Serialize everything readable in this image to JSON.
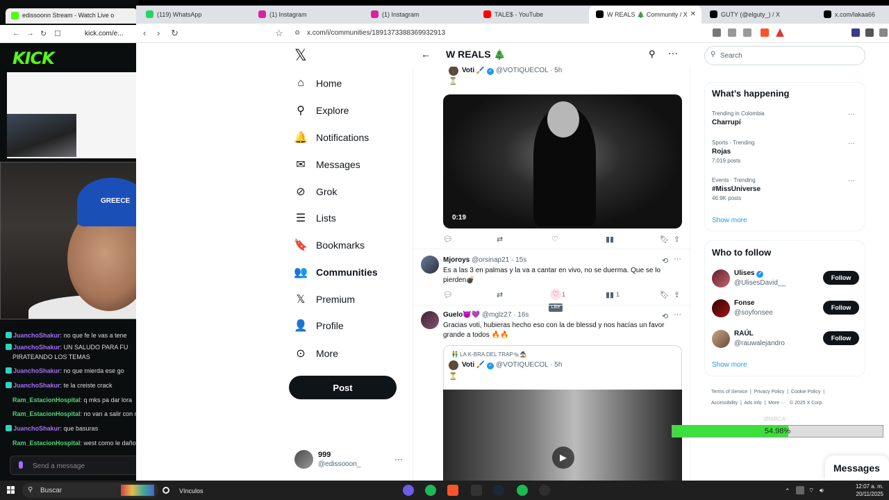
{
  "kick": {
    "tab_title": "edissoonn Stream - Watch Live o",
    "address": "kick.com/e...",
    "logo": "KICK",
    "chat": [
      {
        "user": "JuanchoShakur",
        "text": ": no que fe le vas a tene",
        "color": "u1"
      },
      {
        "user": "JuanchoShakur",
        "text": ": UN SALUDO PARA FU",
        "color": "u1"
      },
      {
        "user": "",
        "text": "PIRATEANDO LOS TEMAS",
        "color": ""
      },
      {
        "user": "JuanchoShakur",
        "text": ": no que mierda ese go",
        "color": "u1"
      },
      {
        "user": "JuanchoShakur",
        "text": ": te la creiste crack",
        "color": "u1"
      },
      {
        "user": "Ram_EstacionHospital",
        "text": ": q mks pa dar lora",
        "color": "u2"
      },
      {
        "user": "Ram_EstacionHospital",
        "text": ": no van a salir con n",
        "color": "u2"
      },
      {
        "user": "JuanchoShakur",
        "text": ": que basuras",
        "color": "u1"
      },
      {
        "user": "Ram_EstacionHospital",
        "text": ": west como le daño",
        "color": "u2"
      }
    ],
    "chat_placeholder": "Send a message"
  },
  "webcam": {
    "cap_text": "GREECE"
  },
  "browser": {
    "tabs": [
      {
        "label": "(119) WhatsApp",
        "color": "#25d366"
      },
      {
        "label": "(1) Instagram",
        "color": "#d6249f"
      },
      {
        "label": "(1) Instagram",
        "color": "#d6249f"
      },
      {
        "label": "TALE$ - YouTube",
        "color": "#ff0000"
      },
      {
        "label": "W REALS 🎄 Community / X",
        "color": "#000000"
      },
      {
        "label": "GUTY (@elguty_) / X",
        "color": "#000000"
      },
      {
        "label": "x.com/lakaa66",
        "color": "#000000"
      }
    ],
    "url": "x.com/i/communities/1891373388369932913"
  },
  "x": {
    "nav": [
      {
        "label": "Home",
        "icon": "home-icon",
        "glyph": "⌂"
      },
      {
        "label": "Explore",
        "icon": "search-icon",
        "glyph": "⚲"
      },
      {
        "label": "Notifications",
        "icon": "bell-icon",
        "glyph": "🔔"
      },
      {
        "label": "Messages",
        "icon": "mail-icon",
        "glyph": "✉"
      },
      {
        "label": "Grok",
        "icon": "grok-icon",
        "glyph": "⊘"
      },
      {
        "label": "Lists",
        "icon": "list-icon",
        "glyph": "☰"
      },
      {
        "label": "Bookmarks",
        "icon": "bookmark-icon",
        "glyph": "🔖"
      },
      {
        "label": "Communities",
        "icon": "communities-icon",
        "glyph": "👥"
      },
      {
        "label": "Premium",
        "icon": "premium-icon",
        "glyph": "𝕏"
      },
      {
        "label": "Profile",
        "icon": "profile-icon",
        "glyph": "👤"
      },
      {
        "label": "More",
        "icon": "more-circle-icon",
        "glyph": "⊙"
      }
    ],
    "post_label": "Post",
    "account": {
      "name": "999",
      "handle": "@edissooon_"
    },
    "community_title": "W REALS 🎄",
    "tweets": {
      "t1": {
        "name": "Voti 🖌️",
        "handle": "@VOTIQUECOL · 5h",
        "text": "⏳",
        "duration": "0:19"
      },
      "t2": {
        "name": "Mjoroys",
        "handle": "@orsinap21 · 15s",
        "text": "Es a las 3 en palmas y la va a cantar en vivo, no se duerma. Que se lo pierden💣",
        "likes": "1",
        "views": "1",
        "tooltip": "Like"
      },
      "t3": {
        "name": "Guelo😈💜",
        "handle": "@mglz27 · 16s",
        "text": "Gracias voti, hubieras hecho eso con la de blessd y nos hacías un favor grande a todos 🔥🔥",
        "quote_context": "👬 LA K-BRA DEL TRAP🐀🧙",
        "quote_name": "Voti 🖌️",
        "quote_handle": "@VOTIQUECOL · 5h",
        "quote_text": "⏳"
      }
    },
    "search_placeholder": "Search",
    "whats_happening": {
      "title": "What’s happening",
      "items": [
        {
          "category": "Trending in Colombia",
          "topic": "Charrupí",
          "count": ""
        },
        {
          "category": "Sports · Trending",
          "topic": "Rojas",
          "count": "7,019 posts"
        },
        {
          "category": "Events · Trending",
          "topic": "#MissUniverse",
          "count": "46.9K posts"
        }
      ],
      "show_more": "Show more"
    },
    "who_to_follow": {
      "title": "Who to follow",
      "items": [
        {
          "name": "Ulises",
          "handle": "@UlisesDavid__",
          "button": "Follow"
        },
        {
          "name": "Fonse",
          "handle": "@soyfonsee",
          "button": "Follow"
        },
        {
          "name": "RAÚL",
          "handle": "@rauwalejandro",
          "button": "Follow"
        }
      ],
      "show_more": "Show more"
    },
    "footer": [
      "Terms of Service",
      "Privacy Policy",
      "Cookie Policy",
      "Accessibility",
      "Ads info",
      "More ···",
      "© 2025 X Corp."
    ],
    "messages_drawer": "Messages"
  },
  "overlay": {
    "progress_text": "54.98%",
    "progress_value": 54.98,
    "watermark": "ØNIRCA"
  },
  "taskbar": {
    "search": "Buscar",
    "vinculos": "Vínculos",
    "time": "12:07 a. m.",
    "date": "20/11/2025"
  }
}
